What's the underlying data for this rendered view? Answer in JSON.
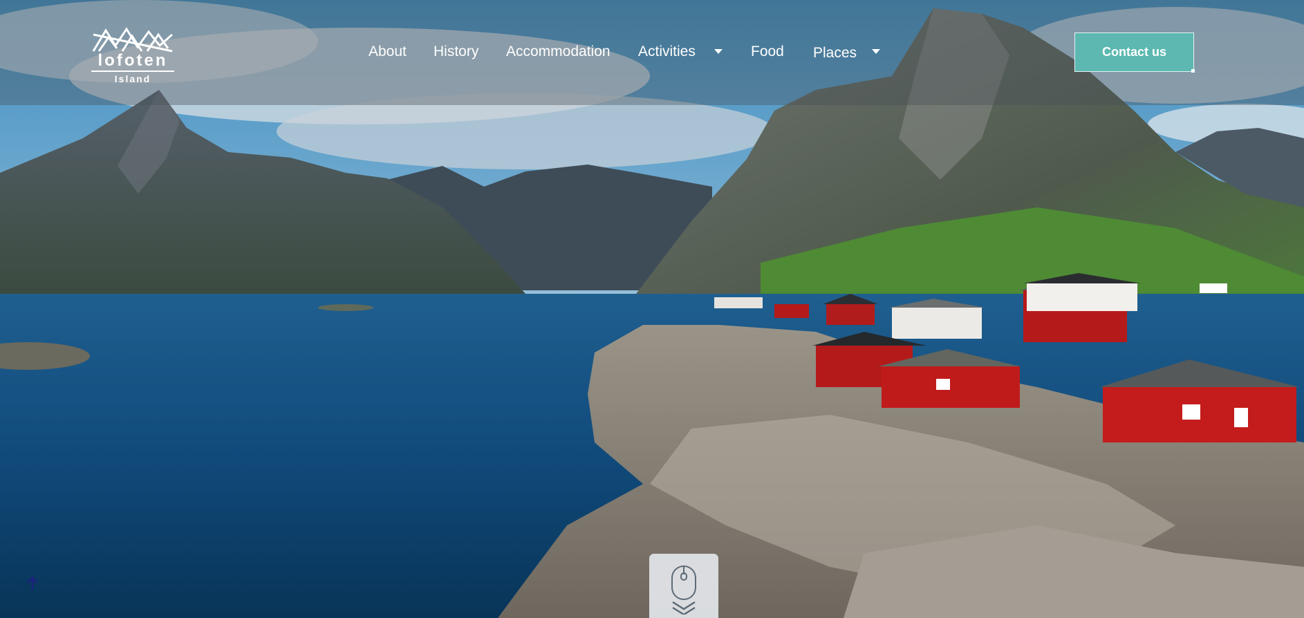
{
  "brand": {
    "logo_word": "lofoten",
    "logo_sub": "Island",
    "logo_icon": "mountains-logo-icon"
  },
  "nav": {
    "items": [
      {
        "label": "About",
        "has_dropdown": false
      },
      {
        "label": "History",
        "has_dropdown": false
      },
      {
        "label": "Accommodation",
        "has_dropdown": false
      },
      {
        "label": "Activities",
        "has_dropdown": true
      },
      {
        "label": "Food",
        "has_dropdown": false
      },
      {
        "label": "Places",
        "has_dropdown": true
      }
    ],
    "dropdown_icon": "caret-down-icon"
  },
  "contact_button": {
    "label": "Contact us",
    "color": "#5cb8b0"
  },
  "hero": {
    "image_subject": "landscape-photo",
    "scroll_icon": "mouse-scroll-icon",
    "scroll_hint_icon": "double-chevron-down-icon"
  },
  "back_to_top": {
    "icon": "arrow-up-icon",
    "color": "#1a237e"
  },
  "colors": {
    "navbar_overlay": "rgba(70, 78, 86, 0.38)",
    "accent": "#5cb8b0",
    "text": "#ffffff"
  }
}
